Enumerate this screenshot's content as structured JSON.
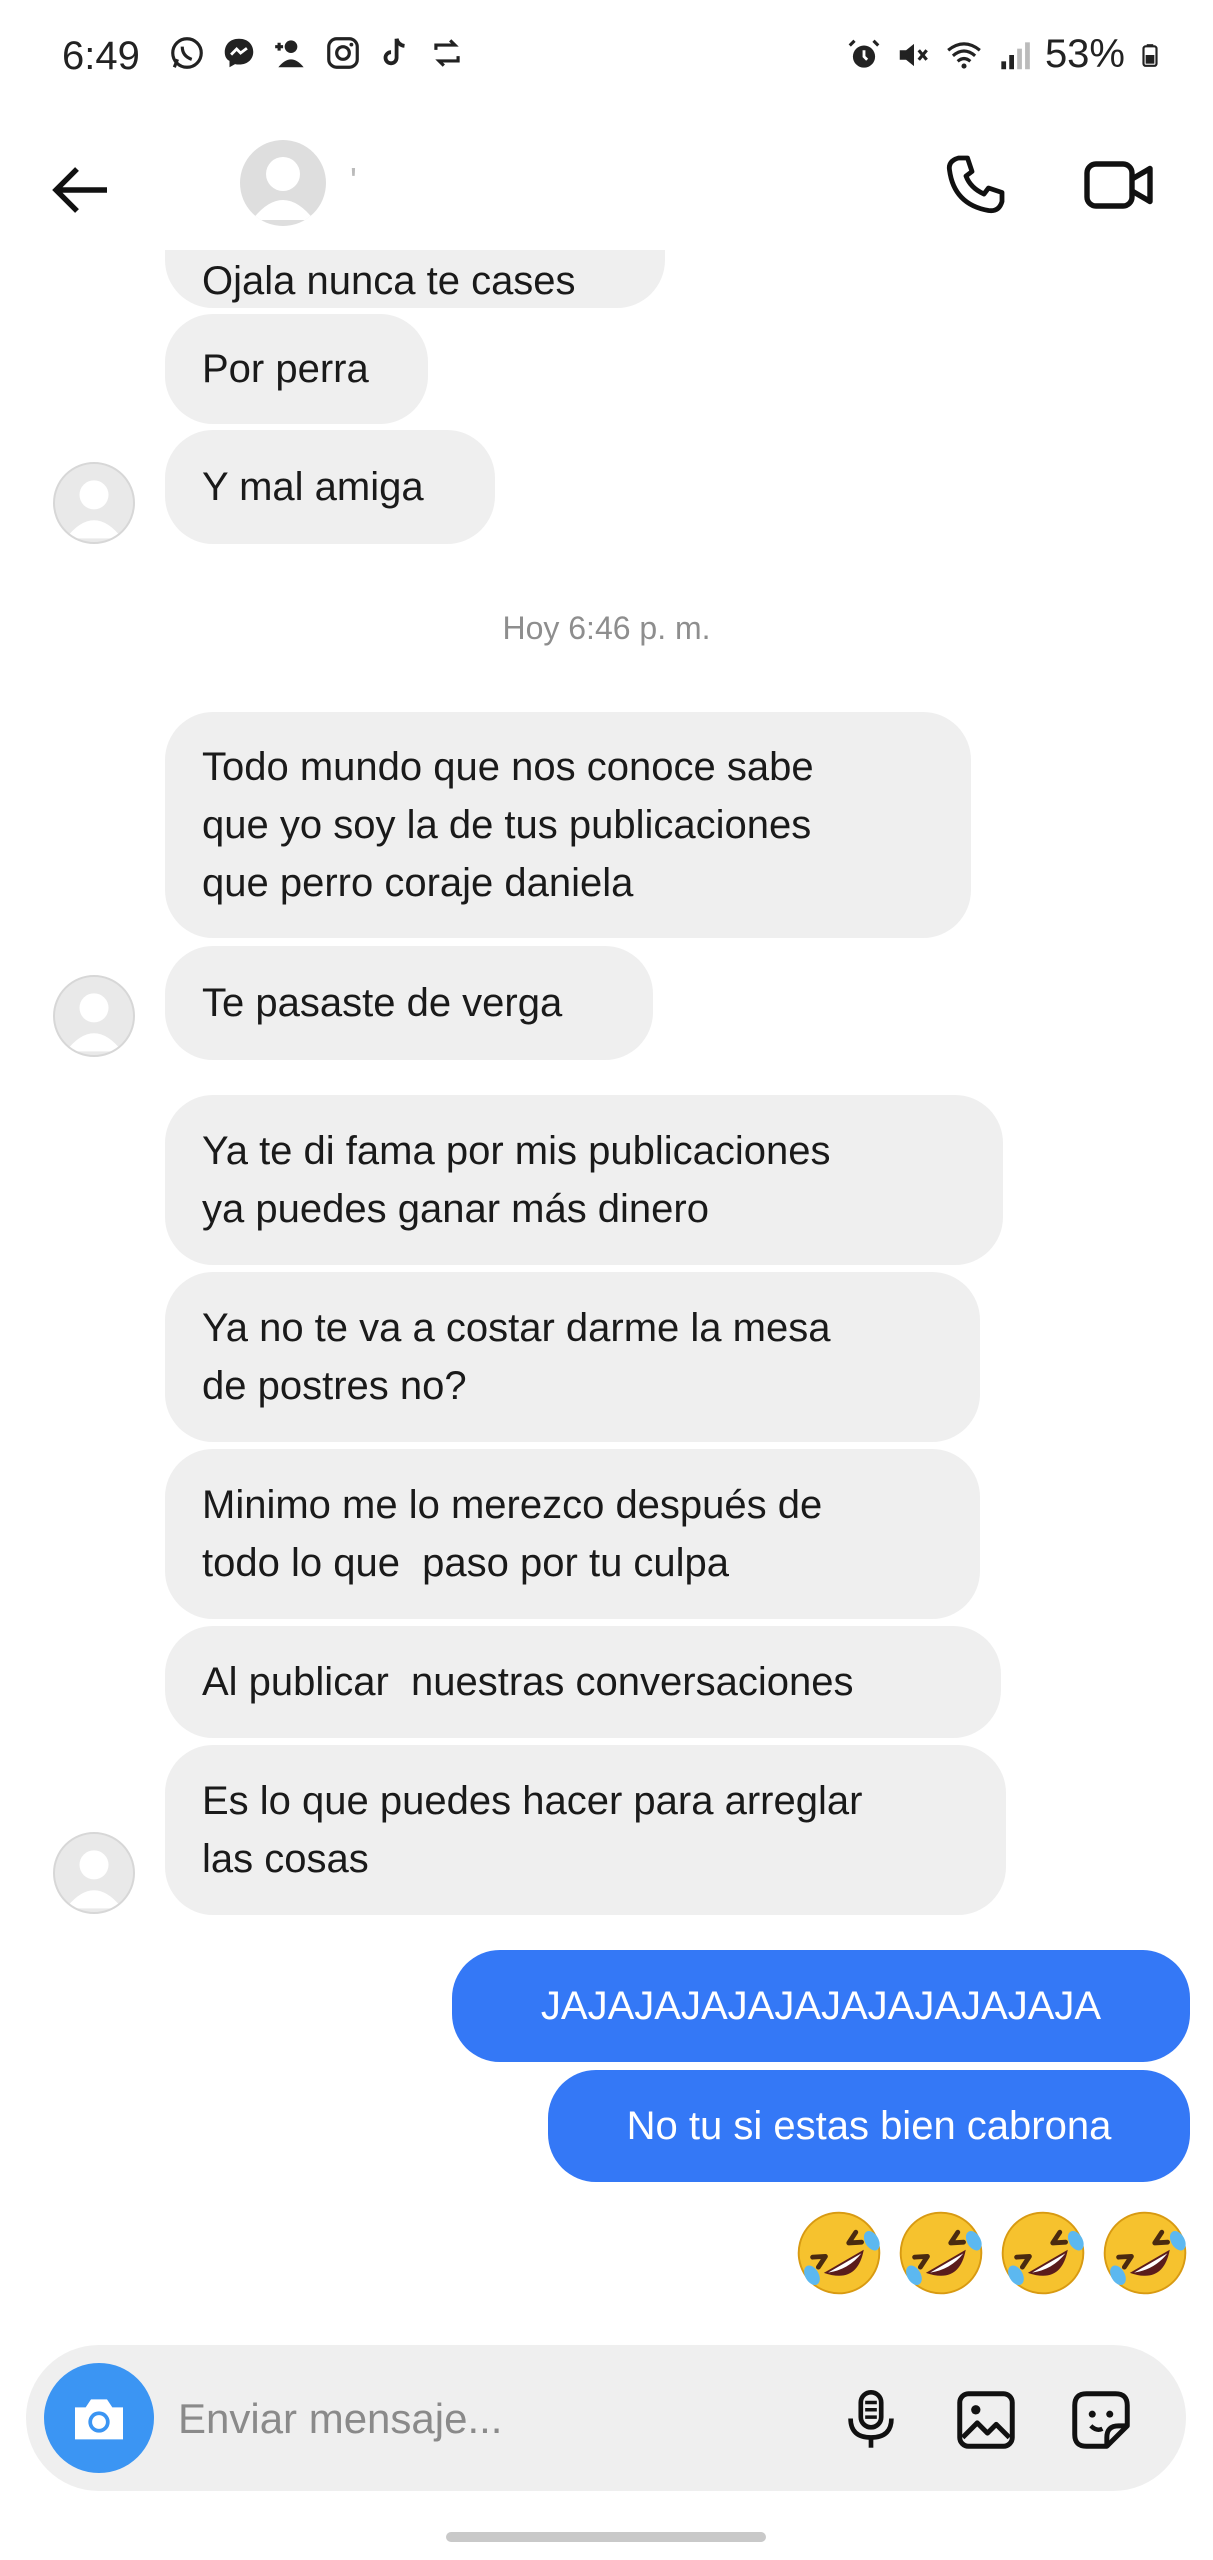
{
  "status_bar": {
    "time": "6:49",
    "battery": "53%",
    "left_icons": [
      "whatsapp-icon",
      "messenger-icon",
      "add-user-icon",
      "instagram-icon",
      "tiktok-icon",
      "repost-icon"
    ],
    "right_icons": [
      "alarm-icon",
      "mute-icon",
      "wifi-icon",
      "signal-icon",
      "battery-icon"
    ]
  },
  "header": {
    "contact_name": "'"
  },
  "messages": {
    "partial_top": "Ojala nunca te cases",
    "m1": "Por perra",
    "m2": "Y mal amiga",
    "timestamp": "Hoy 6:46 p. m.",
    "m3": "Todo mundo que nos conoce sabe\nque yo soy la de tus publicaciones\nque perro coraje daniela",
    "m4": "Te pasaste de verga",
    "m5": "Ya te di fama por mis publicaciones\nya puedes ganar más dinero",
    "m6": "Ya no te va a costar darme la mesa\nde postres no?",
    "m7": "Minimo me lo merezco después de\ntodo lo que  paso por tu culpa",
    "m8": "Al publicar  nuestras conversaciones",
    "m9": "Es lo que puedes hacer para arreglar\nlas cosas",
    "out1": "JAJAJAJAJAJAJAJAJAJAJAJA",
    "out2": "No tu si estas bien cabrona",
    "emojis": [
      "rolling-on-floor-laughing-emoji",
      "rolling-on-floor-laughing-emoji",
      "rolling-on-floor-laughing-emoji",
      "rolling-on-floor-laughing-emoji"
    ]
  },
  "composer": {
    "placeholder": "Enviar mensaje..."
  },
  "colors": {
    "incoming_bubble": "#efefef",
    "outgoing_bubble": "#3478f6",
    "camera_button": "#3b95f3"
  }
}
